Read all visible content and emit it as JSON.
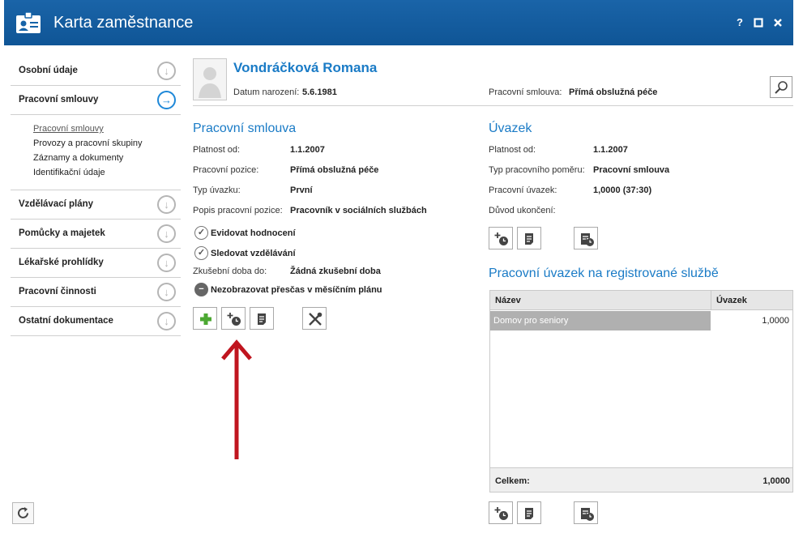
{
  "window": {
    "title": "Karta zaměstnance",
    "help_label": "?",
    "accent_color": "#1563a8"
  },
  "sidebar": {
    "items": [
      {
        "label": "Osobní údaje"
      },
      {
        "label": "Pracovní smlouvy"
      },
      {
        "label": "Vzdělávací plány"
      },
      {
        "label": "Pomůcky a majetek"
      },
      {
        "label": "Lékařské prohlídky"
      },
      {
        "label": "Pracovní činnosti"
      },
      {
        "label": "Ostatní dokumentace"
      }
    ],
    "subitems": [
      {
        "label": "Pracovní smlouvy"
      },
      {
        "label": "Provozy a pracovní skupiny"
      },
      {
        "label": "Záznamy a dokumenty"
      },
      {
        "label": "Identifikační údaje"
      }
    ]
  },
  "header": {
    "name": "Vondráčková Romana",
    "birth_label": "Datum narození:",
    "birth_value": "5.6.1981",
    "contract_label": "Pracovní smlouva:",
    "contract_value": "Přímá obslužná péče"
  },
  "contract": {
    "title": "Pracovní smlouva",
    "rows": [
      {
        "label": "Platnost od:",
        "value": "1.1.2007"
      },
      {
        "label": "Pracovní pozice:",
        "value": "Přímá obslužná péče"
      },
      {
        "label": "Typ úvazku:",
        "value": "První"
      },
      {
        "label": "Popis pracovní pozice:",
        "value": "Pracovník v sociálních službách"
      }
    ],
    "check_rating": "Evidovat hodnocení",
    "check_education": "Sledovat vzdělávání",
    "probation_label": "Zkušební doba do:",
    "probation_value": "Žádná zkušební doba",
    "overtime": "Nezobrazovat přesčas v měsíčním plánu"
  },
  "workload": {
    "title": "Úvazek",
    "rows": [
      {
        "label": "Platnost od:",
        "value": "1.1.2007"
      },
      {
        "label": "Typ pracovního poměru:",
        "value": "Pracovní smlouva"
      },
      {
        "label": "Pracovní úvazek:",
        "value": "1,0000 (37:30)"
      },
      {
        "label": "Důvod ukončení:",
        "value": ""
      }
    ]
  },
  "registered": {
    "title": "Pracovní úvazek na registrované službě",
    "col_name": "Název",
    "col_load": "Úvazek",
    "rows": [
      {
        "name": "Domov pro seniory",
        "load": "1,0000"
      }
    ],
    "total_label": "Celkem:",
    "total_value": "1,0000"
  }
}
